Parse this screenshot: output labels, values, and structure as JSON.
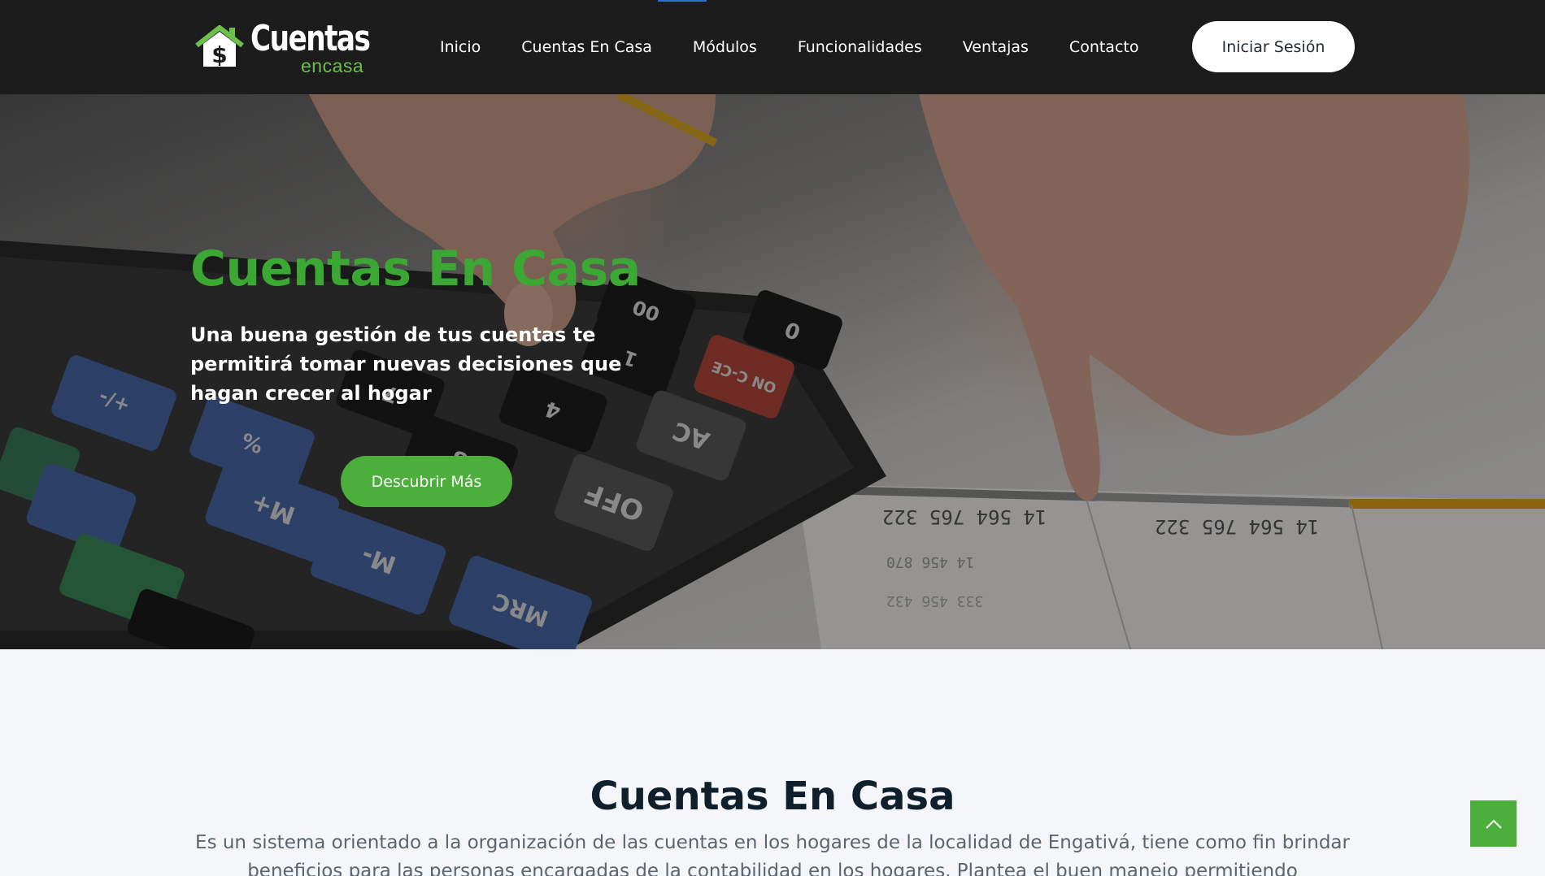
{
  "nav": {
    "logo_word": "Cuentas",
    "logo_sub": "encasa",
    "links": [
      "Inicio",
      "Cuentas En Casa",
      "Módulos",
      "Funcionalidades",
      "Ventajas",
      "Contacto"
    ],
    "login_label": "Iniciar Sesión"
  },
  "hero": {
    "title": "Cuentas En Casa",
    "subtitle": "Una buena gestión de tus cuentas te permitirá tomar nuevas decisiones que hagan crecer al hogar",
    "cta_label": "Descubrir Más",
    "photo_texts": [
      "14 564 765 322",
      "14 564 765 322",
      "14 456 870",
      "333 456 432",
      "00",
      "0",
      "1",
      "4",
      "7",
      "8",
      "AC",
      "ON C-CE",
      "OFF",
      "M+",
      "M-",
      "MRC",
      "%",
      "+/-"
    ]
  },
  "about": {
    "title": "Cuentas En Casa",
    "text": "Es un sistema orientado a la organización de las cuentas en los hogares de la localidad de Engativá, tiene como fin brindar beneficios para las personas encargadas de la contabilidad en los hogares. Plantea el buen manejo permitiendo"
  },
  "colors": {
    "nav_bg": "#1c1c1c",
    "brand_green": "#4caf3c",
    "title_green": "#3aa832",
    "section_bg": "#f4f6f9"
  },
  "icons": {
    "logo": "house-dollar-icon",
    "back_to_top": "chevron-up-icon"
  }
}
